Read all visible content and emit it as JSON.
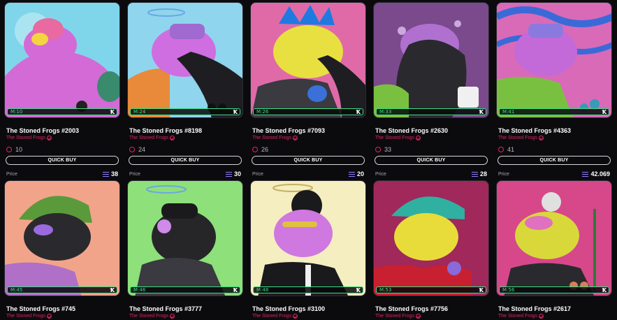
{
  "row1": [
    {
      "name": "The Stoned Frogs #2003",
      "collection": "The Stoned Frogs",
      "rank": "M:10",
      "likes": "10",
      "quick_buy": "QUICK BUY",
      "price_label": "Price",
      "price": "38",
      "bg": "#7fd6ea",
      "skin": "#d46ad6"
    },
    {
      "name": "The Stoned Frogs #8198",
      "collection": "The Stoned Frogs",
      "rank": "M:24",
      "likes": "24",
      "quick_buy": "QUICK BUY",
      "price_label": "Price",
      "price": "30",
      "bg": "#8fd5ee",
      "skin": "#cf6ee0"
    },
    {
      "name": "The Stoned Frogs #7093",
      "collection": "The Stoned Frogs",
      "rank": "M:26",
      "likes": "26",
      "quick_buy": "QUICK BUY",
      "price_label": "Price",
      "price": "20",
      "bg": "#e06aa8",
      "skin": "#e8e040"
    },
    {
      "name": "The Stoned Frogs #2630",
      "collection": "The Stoned Frogs",
      "rank": "M:33",
      "likes": "33",
      "quick_buy": "QUICK BUY",
      "price_label": "Price",
      "price": "28",
      "bg": "#7a4a8c",
      "skin": "#2a2a2e"
    },
    {
      "name": "The Stoned Frogs #4363",
      "collection": "The Stoned Frogs",
      "rank": "M:41",
      "likes": "41",
      "quick_buy": "QUICK BUY",
      "price_label": "Price",
      "price": "42.069",
      "bg": "#d86ab8",
      "skin": "#c46ad8"
    }
  ],
  "row2": [
    {
      "name": "The Stoned Frogs #745",
      "collection": "The Stoned Frogs",
      "rank": "M:45",
      "bg": "#f2a48a",
      "skin": "#2a2a2e"
    },
    {
      "name": "The Stoned Frogs #3777",
      "collection": "The Stoned Frogs",
      "rank": "M:46",
      "bg": "#8ee07a",
      "skin": "#262629"
    },
    {
      "name": "The Stoned Frogs #3100",
      "collection": "The Stoned Frogs",
      "rank": "M:48",
      "bg": "#f5eec0",
      "skin": "#cf78e0"
    },
    {
      "name": "The Stoned Frogs #7756",
      "collection": "The Stoned Frogs",
      "rank": "M:53",
      "bg": "#a0285a",
      "skin": "#e8dc3a"
    },
    {
      "name": "The Stoned Frogs #2617",
      "collection": "The Stoned Frogs",
      "rank": "M:56",
      "bg": "#d6488a",
      "skin": "#d8d83a"
    }
  ],
  "icons": {
    "verified": "verified-check-icon",
    "likes": "heart-outline-icon",
    "currency": "eth-icon",
    "marketplace": "marketplace-logo-icon"
  },
  "colors": {
    "accent": "#e0245e",
    "rank_green": "#3ddc84",
    "currency": "#8f7bff"
  }
}
